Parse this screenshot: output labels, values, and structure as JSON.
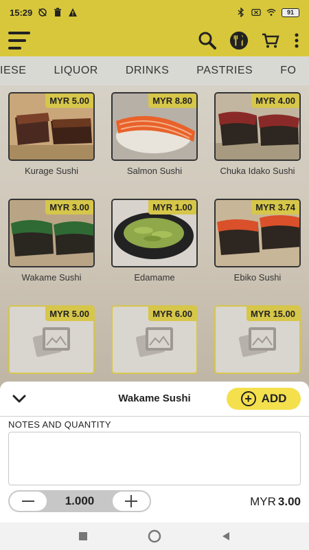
{
  "status": {
    "time": "15:29",
    "battery": "91"
  },
  "appbar": {
    "menu_icon": "hamburger-menu-icon",
    "search_icon": "search-icon",
    "dining_icon": "dining-icon",
    "cart_icon": "cart-icon",
    "more_icon": "more-vertical-icon"
  },
  "tabs": [
    "IESE",
    "LIQUOR",
    "DRINKS",
    "PASTRIES",
    "FO"
  ],
  "items": [
    {
      "name": "Kurage Sushi",
      "price": "MYR 5.00"
    },
    {
      "name": "Salmon Sushi",
      "price": "MYR 8.80"
    },
    {
      "name": "Chuka Idako Sushi",
      "price": "MYR 4.00"
    },
    {
      "name": "Wakame Sushi",
      "price": "MYR 3.00"
    },
    {
      "name": "Edamame",
      "price": "MYR 1.00"
    },
    {
      "name": "Ebiko Sushi",
      "price": "MYR 3.74"
    },
    {
      "name": "",
      "price": "MYR 5.00"
    },
    {
      "name": "",
      "price": "MYR 6.00"
    },
    {
      "name": "",
      "price": "MYR 15.00"
    }
  ],
  "sheet": {
    "title": "Wakame Sushi",
    "add_label": "ADD",
    "notes_label": "NOTES AND QUANTITY",
    "quantity": "1.000",
    "currency": "MYR",
    "total": "3.00"
  },
  "colors": {
    "accent": "#d8c73a",
    "button": "#f4e04d"
  }
}
